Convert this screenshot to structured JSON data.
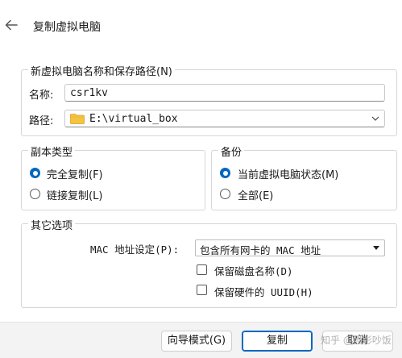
{
  "header": {
    "title": "复制虚拟电脑"
  },
  "name_group": {
    "title": "新虚拟电脑名称和保存路径(N)",
    "name_label": "名称:",
    "name_value": "csr1kv",
    "path_label": "路径:",
    "path_value": "E:\\virtual_box"
  },
  "clone_type": {
    "title": "副本类型",
    "options": [
      {
        "label": "完全复制(F)",
        "selected": true
      },
      {
        "label": "链接复制(L)",
        "selected": false
      }
    ]
  },
  "snapshots": {
    "title": "备份",
    "options": [
      {
        "label": "当前虚拟电脑状态(M)",
        "selected": true
      },
      {
        "label": "全部(E)",
        "selected": false
      }
    ]
  },
  "other": {
    "title": "其它选项",
    "mac_label": "MAC 地址设定(P):",
    "mac_value": "包含所有网卡的 MAC 地址",
    "checks": [
      {
        "label": "保留磁盘名称(D)",
        "checked": false
      },
      {
        "label": "保留硬件的 UUID(H)",
        "checked": false
      }
    ]
  },
  "footer": {
    "expert_button": "向导模式(G)",
    "clone_button": "复制",
    "cancel_button": "取消"
  },
  "watermark": "知乎 @孤影吵饭",
  "colors": {
    "accent": "#0067c0",
    "folder": "#f5c342"
  }
}
